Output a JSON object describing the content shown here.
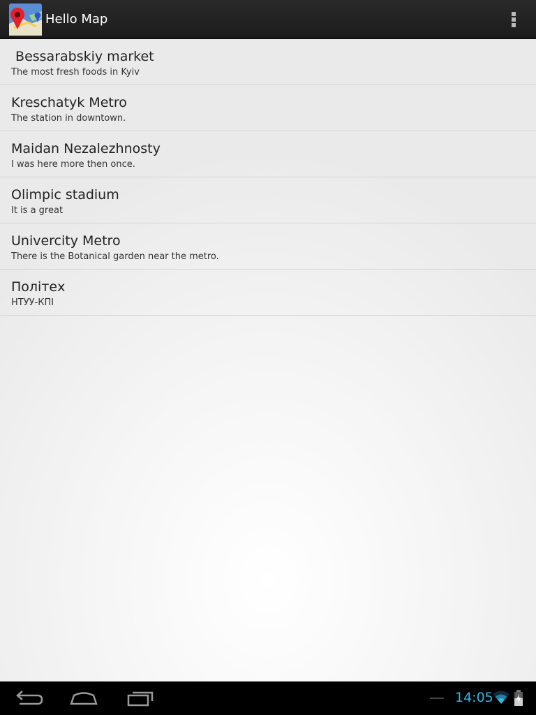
{
  "app": {
    "title": "Hello Map",
    "icon": "map-pin-app-icon",
    "menu_icon": "overflow-menu-icon"
  },
  "places": [
    {
      "title": " Bessarabskiy market",
      "subtitle": "The most fresh foods in Kyiv"
    },
    {
      "title": "Kreschatyk Metro",
      "subtitle": "The station in downtown."
    },
    {
      "title": "Maidan Nezalezhnosty",
      "subtitle": "I was here more then once."
    },
    {
      "title": "Olimpic stadium",
      "subtitle": "It is a great"
    },
    {
      "title": "Univercity Metro",
      "subtitle": "There is the Botanical garden near the metro."
    },
    {
      "title": "Політех",
      "subtitle": "НТУУ-КПІ"
    }
  ],
  "system_bar": {
    "time": "14:05",
    "nav_icons": [
      "back-icon",
      "home-icon",
      "recent-apps-icon"
    ],
    "status_icons": [
      "notification-dash-icon",
      "wifi-icon",
      "battery-charging-icon"
    ],
    "clock_color": "#33b5e5"
  },
  "colors": {
    "action_bar": "#222222",
    "divider": "#d4d4d4",
    "nav_bar": "#000000"
  }
}
